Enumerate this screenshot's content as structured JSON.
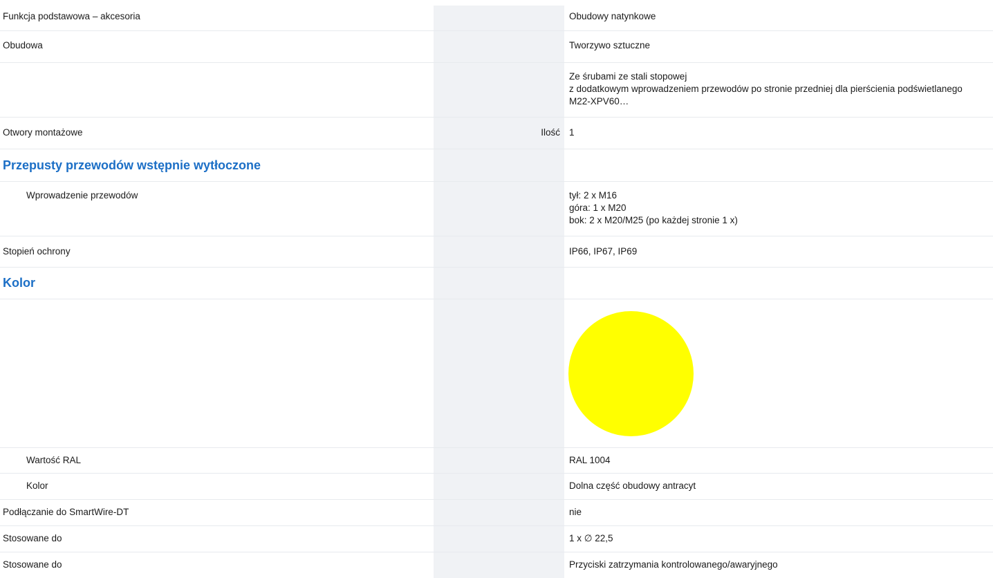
{
  "rows": [
    {
      "label": "Funkcja podstawowa – akcesoria",
      "qualifier": "",
      "value": "Obudowy natynkowe"
    },
    {
      "label": "Obudowa",
      "qualifier": "",
      "value": "Tworzywo sztuczne"
    },
    {
      "label": "",
      "qualifier": "",
      "value": "Ze śrubami ze stali stopowej\nz dodatkowym wprowadzeniem przewodów po stronie przedniej dla pierścienia podświetlanego M22-XPV60…"
    },
    {
      "label": "Otwory montażowe",
      "qualifier": "Ilość",
      "value": "1"
    },
    {
      "section": "Przepusty przewodów wstępnie wytłoczone"
    },
    {
      "label": "Wprowadzenie przewodów",
      "qualifier": "",
      "value": "tył: 2 x M16\ngóra: 1 x M20\nbok: 2 x M20/M25 (po każdej stronie 1 x)"
    },
    {
      "label": "Stopień ochrony",
      "qualifier": "",
      "value": "IP66, IP67, IP69"
    },
    {
      "section": "Kolor"
    },
    {
      "label": "Wartość RAL",
      "qualifier": "",
      "value": "RAL 1004"
    },
    {
      "label": "Kolor",
      "qualifier": "",
      "value": "Dolna część obudowy antracyt"
    },
    {
      "label": "Podłączanie do SmartWire-DT",
      "qualifier": "",
      "value": "nie"
    },
    {
      "label": "Stosowane do",
      "qualifier": "",
      "value": "1 x ∅ 22,5"
    },
    {
      "label": "Stosowane do",
      "qualifier": "",
      "value": "Przyciski zatrzymania kontrolowanego/awaryjnego"
    }
  ],
  "color_swatch": {
    "color": "#ffff00"
  },
  "colors": {
    "accent": "#1c6fc6",
    "column_shade": "#f0f2f5",
    "divider": "#e7eaee"
  }
}
